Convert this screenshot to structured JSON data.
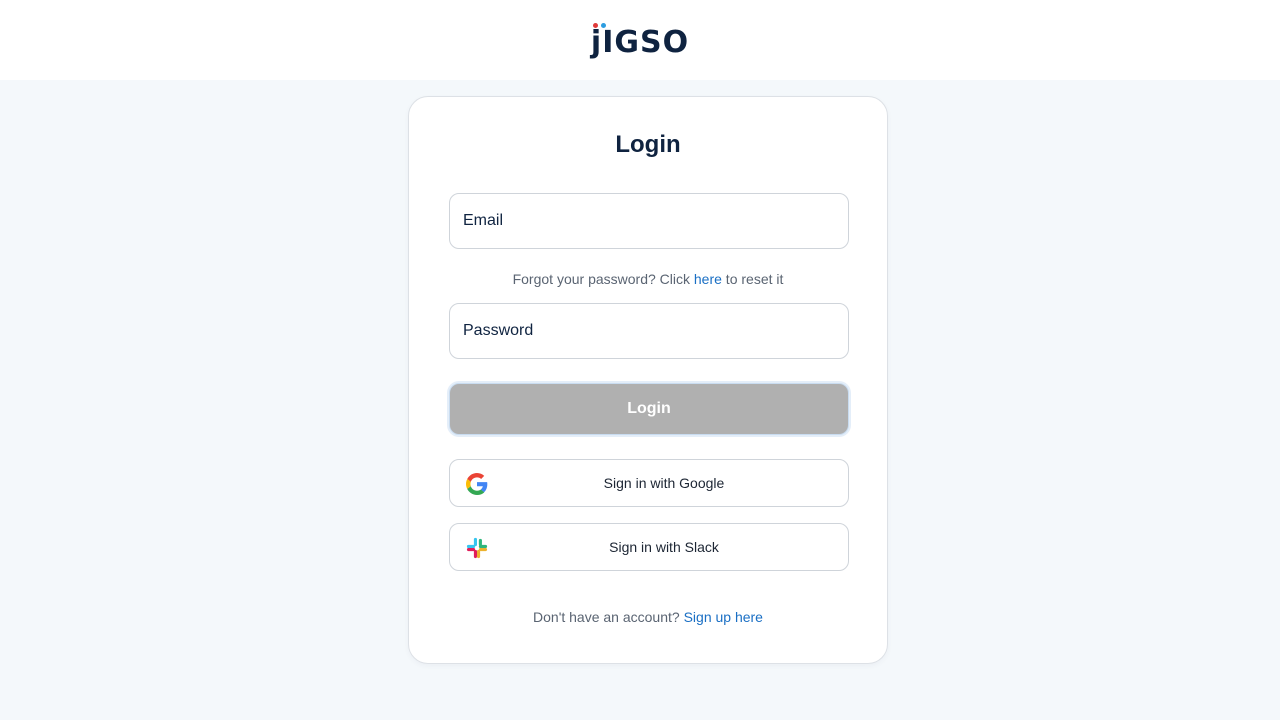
{
  "header": {
    "logo_text_j": "j",
    "logo_text_rest": "IGSO",
    "logo_dot_colors": [
      "#e03a3a",
      "#2d9de0"
    ]
  },
  "login_card": {
    "title": "Login",
    "email_placeholder": "Email",
    "forgot_prefix": "Forgot your password? Click ",
    "forgot_link": "here",
    "forgot_suffix": " to reset it",
    "password_placeholder": "Password",
    "login_button": "Login",
    "google_button": "Sign in with Google",
    "slack_button": "Sign in with Slack",
    "signup_prefix": "Don't have an account? ",
    "signup_link": "Sign up here"
  },
  "icons": {
    "google": "google-icon",
    "slack": "slack-icon"
  },
  "colors": {
    "brand_navy": "#0f2340",
    "link_blue": "#1a6fc4",
    "login_button_disabled": "#b0b0b0",
    "page_background": "#f4f8fb"
  }
}
